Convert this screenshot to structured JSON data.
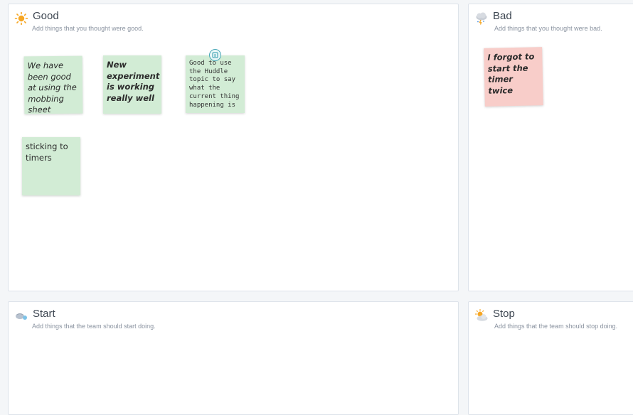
{
  "columns": {
    "good": {
      "title": "Good",
      "subtitle": "Add things that you thought were good.",
      "icon": "sun-icon",
      "notes": [
        {
          "text": "We have been good at using the mobbing sheet",
          "color": "#d2ecd5"
        },
        {
          "text": "New experiment is working really well",
          "color": "#d2ecd5"
        },
        {
          "text": "Good to use the Huddle topic to say what the current thing happening is",
          "color": "#d2ecd5",
          "badge_icon": "huddle-icon"
        },
        {
          "text": "sticking to timers",
          "color": "#d2ecd5"
        }
      ]
    },
    "bad": {
      "title": "Bad",
      "subtitle": "Add things that you thought were bad.",
      "icon": "storm-cloud-icon",
      "notes": [
        {
          "text": "I forgot to start the timer twice",
          "color": "#f8cdc9"
        }
      ]
    },
    "start": {
      "title": "Start",
      "subtitle": "Add things that the team should start doing.",
      "icon": "sprout-icon"
    },
    "stop": {
      "title": "Stop",
      "subtitle": "Add things that the team should stop doing.",
      "icon": "sun-behind-cloud-icon"
    }
  }
}
